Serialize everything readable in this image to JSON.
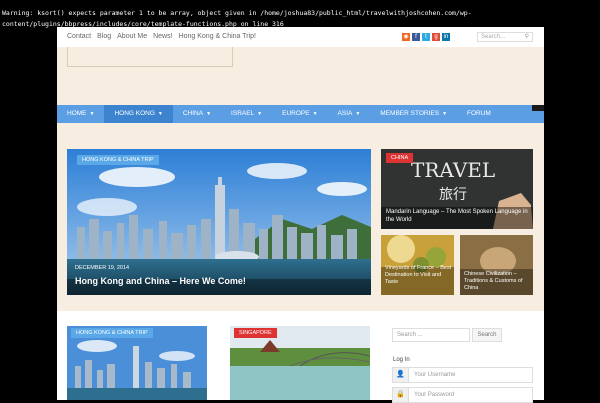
{
  "warning": "Warning: ksort() expects parameter 1 to be array, object given in /home/joshua83/public_html/travelwithjoshcohen.com/wp-content/plugins/bbpress/includes/core/template-functions.php on line 316",
  "topbar": {
    "links": [
      "Contact",
      "Blog",
      "About Me",
      "News!",
      "Hong Kong & China Trip!"
    ],
    "search_placeholder": "Search..."
  },
  "social": [
    {
      "icon": "rss-icon",
      "color": "#f26522"
    },
    {
      "icon": "facebook-icon",
      "color": "#3b5998"
    },
    {
      "icon": "twitter-icon",
      "color": "#2fa9e0"
    },
    {
      "icon": "google-plus-icon",
      "color": "#dd4b39"
    },
    {
      "icon": "linkedin-icon",
      "color": "#0e76a8"
    }
  ],
  "nav": {
    "items": [
      {
        "label": "HOME",
        "caret": true
      },
      {
        "label": "HONG KONG",
        "caret": true
      },
      {
        "label": "CHINA",
        "caret": true
      },
      {
        "label": "ISRAEL",
        "caret": true
      },
      {
        "label": "EUROPE",
        "caret": true
      },
      {
        "label": "ASIA",
        "caret": true
      },
      {
        "label": "MEMBER STORIES",
        "caret": true
      },
      {
        "label": "FORUM",
        "caret": false
      }
    ],
    "active_index": 1,
    "accent": "#5b9ee3"
  },
  "hero": {
    "tag": "HONG KONG & CHINA TRIP",
    "date": "DECEMBER 19, 2014",
    "title": "Hong Kong and China – Here We Come!"
  },
  "side_tiles": [
    {
      "tag": "CHINA",
      "caption": "Mandarin Language – The Most Spoken Language in the World"
    },
    {
      "tag": "",
      "caption": "Vineyards of France – Best Destination to Visit and Taste"
    },
    {
      "tag": "",
      "caption": "Chinese Civilization – Traditions & Customs of China"
    }
  ],
  "chalk_text": {
    "line1": "TRAVEL",
    "line2": "旅行"
  },
  "cards": [
    {
      "tag": "HONG KONG & CHINA TRIP"
    },
    {
      "tag": "SINGAPORE"
    }
  ],
  "sidebar": {
    "search_placeholder": "Search ...",
    "search_button": "Search",
    "login_label": "Log In",
    "username_placeholder": "Your Username",
    "password_placeholder": "Your Password"
  }
}
